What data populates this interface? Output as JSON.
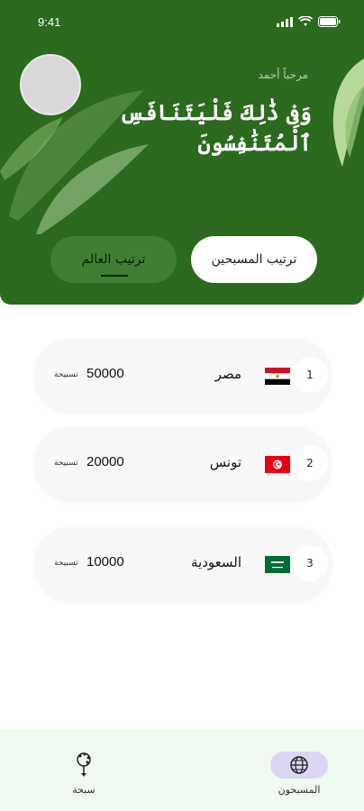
{
  "status_bar": {
    "time": "9:41"
  },
  "header": {
    "greeting": "مرحباً أحمد",
    "verse": "وَفِى ذَٰلِكَ فَلْيَتَنَافَسِ ٱلْمُتَنَٰفِسُونَ"
  },
  "tabs": [
    {
      "label": "ترتيب المسبحين",
      "active": true
    },
    {
      "label": "ترتيب العالم",
      "active": false
    }
  ],
  "rankings": [
    {
      "rank": "1",
      "country": "مصر",
      "score": "50000",
      "unit": "تسبيحة",
      "flag": "egypt-flag-icon"
    },
    {
      "rank": "2",
      "country": "تونس",
      "score": "20000",
      "unit": "تسبيحة",
      "flag": "tunisia-flag-icon"
    },
    {
      "rank": "3",
      "country": "السعودية",
      "score": "10000",
      "unit": "تسبيحة",
      "flag": "saudi-flag-icon"
    }
  ],
  "bottom_nav": [
    {
      "label": "المسبحون",
      "icon": "globe-icon",
      "active": true
    },
    {
      "label": "سبحة",
      "icon": "tasbih-icon",
      "active": false
    }
  ],
  "colors": {
    "primary": "#2b6a1f",
    "tab_inactive": "#3f7e33",
    "nav_bg": "#eef9f0",
    "nav_active": "#dcd6f4"
  }
}
